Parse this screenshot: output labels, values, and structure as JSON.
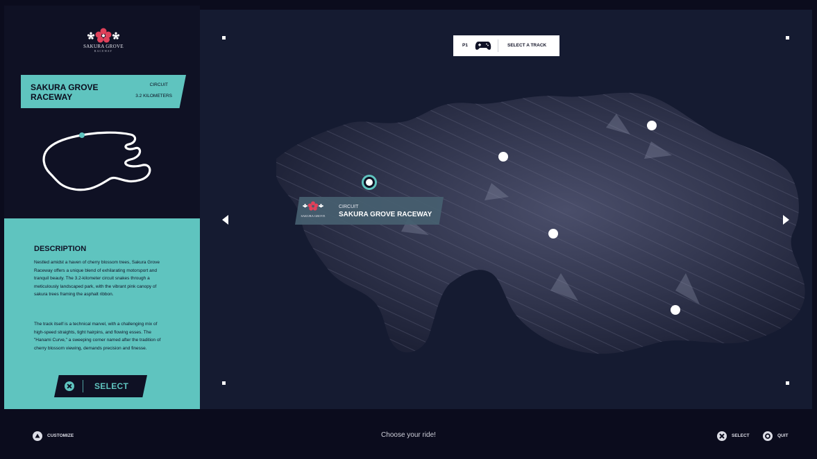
{
  "logo": {
    "name": "SAKURA GROVE",
    "subtitle": "RACEWAY"
  },
  "track_card": {
    "name": "SAKURA GROVE RACEWAY",
    "type": "CIRCUIT",
    "length": "3.2 KILOMETERS"
  },
  "description": {
    "title": "DESCRIPTION",
    "paragraph1": "Nestled amidst a haven of cherry blossom trees, Sakura Grove Raceway offers a unique blend of exhilarating motorsport and tranquil beauty. The 3.2-kilometer circuit snakes through a meticulously landscaped park, with the vibrant pink canopy of sakura trees framing the asphalt ribbon.",
    "paragraph2": "The track itself is a technical marvel, with a challenging mix of high-speed straights, tight hairpins, and flowing esses. The \"Hanami Curve,\" a sweeping corner named after the tradition of cherry blossom viewing, demands precision and finesse."
  },
  "select_button": {
    "label": "SELECT",
    "icon": "cross-icon"
  },
  "player_bar": {
    "player": "P1",
    "icon": "gamepad-icon",
    "title": "SELECT A TRACK"
  },
  "map_label": {
    "type": "CIRCUIT",
    "name": "SAKURA GROVE RACEWAY",
    "logo_text": "SAKURA GROVE"
  },
  "bottom_bar": {
    "left": {
      "icon": "triangle-button-icon",
      "label": "CUSTOMIZE"
    },
    "hint": "Choose your ride!",
    "right": [
      {
        "icon": "cross-button-icon",
        "label": "SELECT"
      },
      {
        "icon": "circle-button-icon",
        "label": "QUIT"
      }
    ]
  },
  "colors": {
    "accent": "#5fc4bf",
    "background": "#0b0c1d",
    "panel": "#0f1124",
    "blossom": "#e0415a"
  }
}
